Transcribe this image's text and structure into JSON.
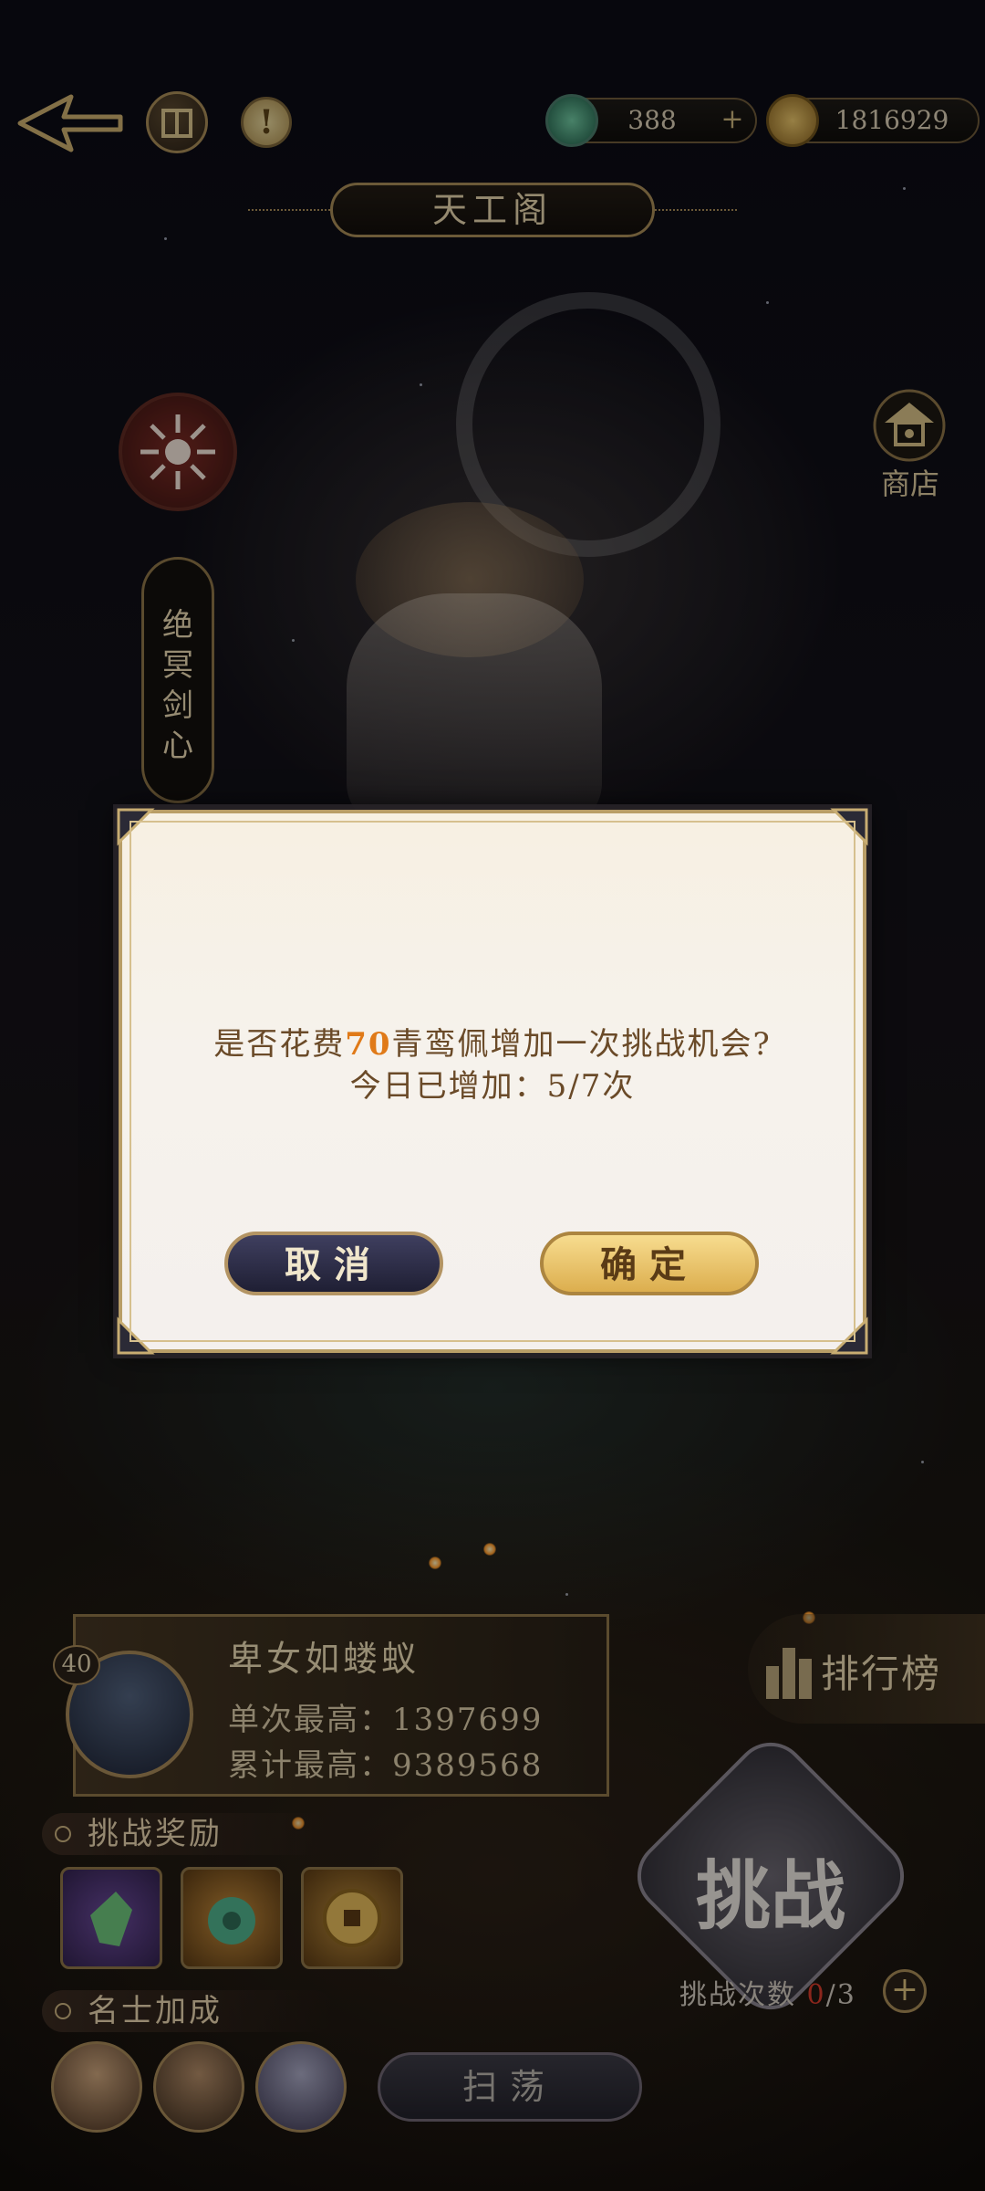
{
  "header": {
    "title": "天工阁",
    "currency_jade": "388",
    "currency_coin": "1816929",
    "info_icon": "exclamation-icon"
  },
  "left_panel": {
    "event_label": "绝冥剑心"
  },
  "shop": {
    "label": "商店"
  },
  "dialog": {
    "line1_prefix": "是否花费",
    "line1_amount": "70",
    "line1_suffix": "青鸾佩增加一次挑战机会?",
    "line2": "今日已增加：5/7次",
    "cancel_label": "取消",
    "confirm_label": "确定"
  },
  "player": {
    "level": "40",
    "name": "卑女如蝼蚁",
    "single_best": "单次最高：1397699",
    "total_best": "累计最高：9389568"
  },
  "rewards": {
    "title": "挑战奖励"
  },
  "buffs": {
    "title": "名士加成"
  },
  "actions": {
    "sweep_label": "扫荡",
    "leaderboard_label": "排行榜",
    "challenge_label": "挑战",
    "challenge_count_prefix": "挑战次数 ",
    "challenge_count_used": "0",
    "challenge_count_total": "/3",
    "plus_label": "+"
  },
  "colors": {
    "highlight": "#e07a18",
    "dialog_text": "#6a4a28",
    "gold_border": "#b99e67"
  }
}
